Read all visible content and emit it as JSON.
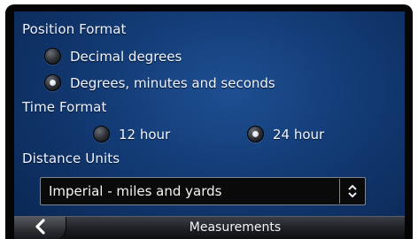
{
  "position_format": {
    "label": "Position Format",
    "options": [
      {
        "label": "Decimal degrees",
        "selected": false
      },
      {
        "label": "Degrees, minutes and seconds",
        "selected": true
      }
    ]
  },
  "time_format": {
    "label": "Time Format",
    "options": [
      {
        "label": "12 hour",
        "selected": false
      },
      {
        "label": "24 hour",
        "selected": true
      }
    ]
  },
  "distance_units": {
    "label": "Distance Units",
    "selected_value": "Imperial - miles and yards",
    "arrow_icon": "up-down-chevron-icon"
  },
  "bottom_bar": {
    "title": "Measurements",
    "back_icon": "chevron-left-icon"
  },
  "colors": {
    "screen_background": "#123a73",
    "select_background": "#0a0a0a",
    "text": "#f2f5fb"
  }
}
